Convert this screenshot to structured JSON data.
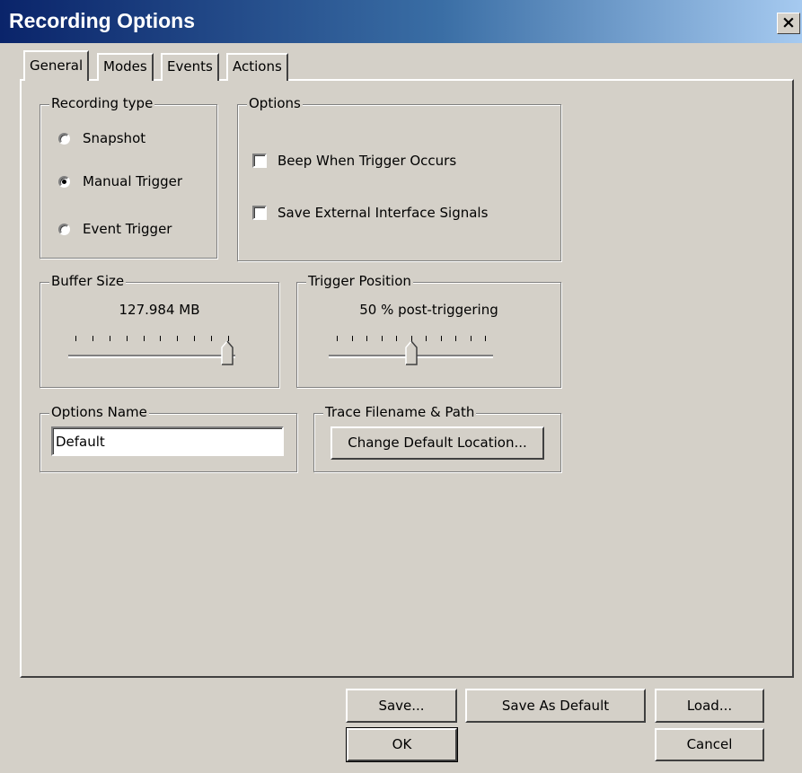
{
  "window": {
    "title": "Recording Options",
    "close_glyph": "×",
    "title_gradient": [
      "#0a246a",
      "#a6caf0"
    ]
  },
  "tabs": [
    {
      "label": "General",
      "active": true
    },
    {
      "label": "Modes",
      "active": false
    },
    {
      "label": "Events",
      "active": false
    },
    {
      "label": "Actions",
      "active": false
    }
  ],
  "recording_type": {
    "label": "Recording type",
    "options": [
      {
        "label": "Snapshot",
        "selected": false
      },
      {
        "label": "Manual Trigger",
        "selected": true
      },
      {
        "label": "Event Trigger",
        "selected": false
      }
    ]
  },
  "options": {
    "label": "Options",
    "items": [
      {
        "label": "Beep When Trigger Occurs",
        "checked": false
      },
      {
        "label": "Save External Interface Signals",
        "checked": false
      }
    ]
  },
  "buffer_size": {
    "label": "Buffer Size",
    "value": "127.984 MB",
    "slider_level": 1.0,
    "tick_count": 10
  },
  "trigger_position": {
    "label": "Trigger Position",
    "value": "50 % post-triggering",
    "slider_level": 0.5,
    "tick_count": 11
  },
  "options_name": {
    "label": "Options Name",
    "value": "Default"
  },
  "trace_path": {
    "label": "Trace Filename & Path",
    "button_label": "Change Default Location..."
  },
  "footer": {
    "save_label": "Save...",
    "save_default_label": "Save As Default",
    "load_label": "Load...",
    "ok_label": "OK",
    "cancel_label": "Cancel"
  }
}
